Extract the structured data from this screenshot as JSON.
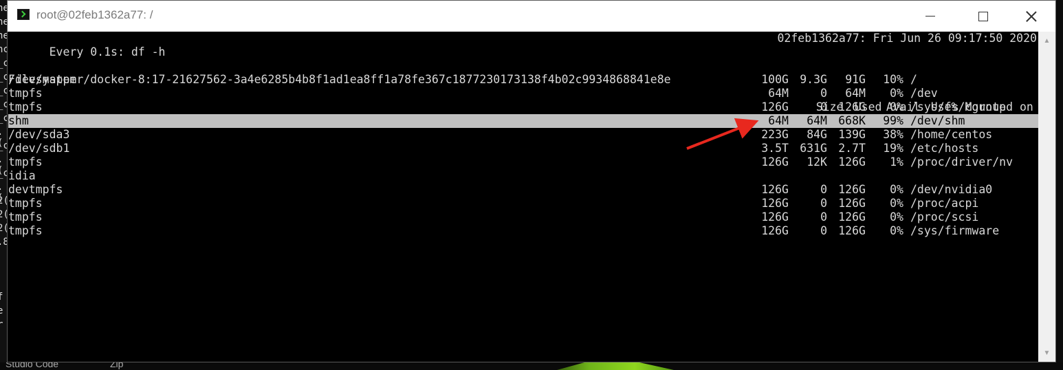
{
  "window": {
    "title": "root@02feb1362a77: /",
    "icon": "terminal-icon"
  },
  "terminal": {
    "watch_cmd": "Every 0.1s: df -h",
    "watch_status": "02feb1362a77: Fri Jun 26 09:17:50 2020",
    "header": {
      "filesystem": "Filesystem",
      "size": "Size",
      "used": "Used",
      "avail": "Avail",
      "use": "Use%",
      "mounted": "Mounted on"
    },
    "rows": [
      {
        "fs": "/dev/mapper/docker-8:17-21627562-3a4e6285b4b8f1ad1ea8ff1a78fe367c1877230173138f4b02c9934868841e8e",
        "size": "100G",
        "used": "9.3G",
        "avail": "91G",
        "use": "10%",
        "mount": "/"
      },
      {
        "fs": "tmpfs",
        "size": "64M",
        "used": "0",
        "avail": "64M",
        "use": "0%",
        "mount": "/dev"
      },
      {
        "fs": "tmpfs",
        "size": "126G",
        "used": "0",
        "avail": "126G",
        "use": "0%",
        "mount": "/sys/fs/cgroup"
      },
      {
        "fs": "shm",
        "size": "64M",
        "used": "64M",
        "avail": "668K",
        "use": "99%",
        "mount": "/dev/shm",
        "highlighted": true
      },
      {
        "fs": "/dev/sda3",
        "size": "223G",
        "used": "84G",
        "avail": "139G",
        "use": "38%",
        "mount": "/home/centos"
      },
      {
        "fs": "/dev/sdb1",
        "size": "3.5T",
        "used": "631G",
        "avail": "2.7T",
        "use": "19%",
        "mount": "/etc/hosts"
      },
      {
        "fs": "tmpfs",
        "size": "126G",
        "used": "12K",
        "avail": "126G",
        "use": "1%",
        "mount": "/proc/driver/nv"
      },
      {
        "fs": "idia",
        "size": "",
        "used": "",
        "avail": "",
        "use": "",
        "mount": ""
      },
      {
        "fs": "devtmpfs",
        "size": "126G",
        "used": "0",
        "avail": "126G",
        "use": "0%",
        "mount": "/dev/nvidia0"
      },
      {
        "fs": "tmpfs",
        "size": "126G",
        "used": "0",
        "avail": "126G",
        "use": "0%",
        "mount": "/proc/acpi"
      },
      {
        "fs": "tmpfs",
        "size": "126G",
        "used": "0",
        "avail": "126G",
        "use": "0%",
        "mount": "/proc/scsi"
      },
      {
        "fs": "tmpfs",
        "size": "126G",
        "used": "0",
        "avail": "126G",
        "use": "0%",
        "mount": "/sys/firmware"
      }
    ]
  },
  "annotation": {
    "color": "#e8281e"
  },
  "desktop": {
    "taskbar_items": [
      "Studio Code",
      "Zip"
    ]
  }
}
